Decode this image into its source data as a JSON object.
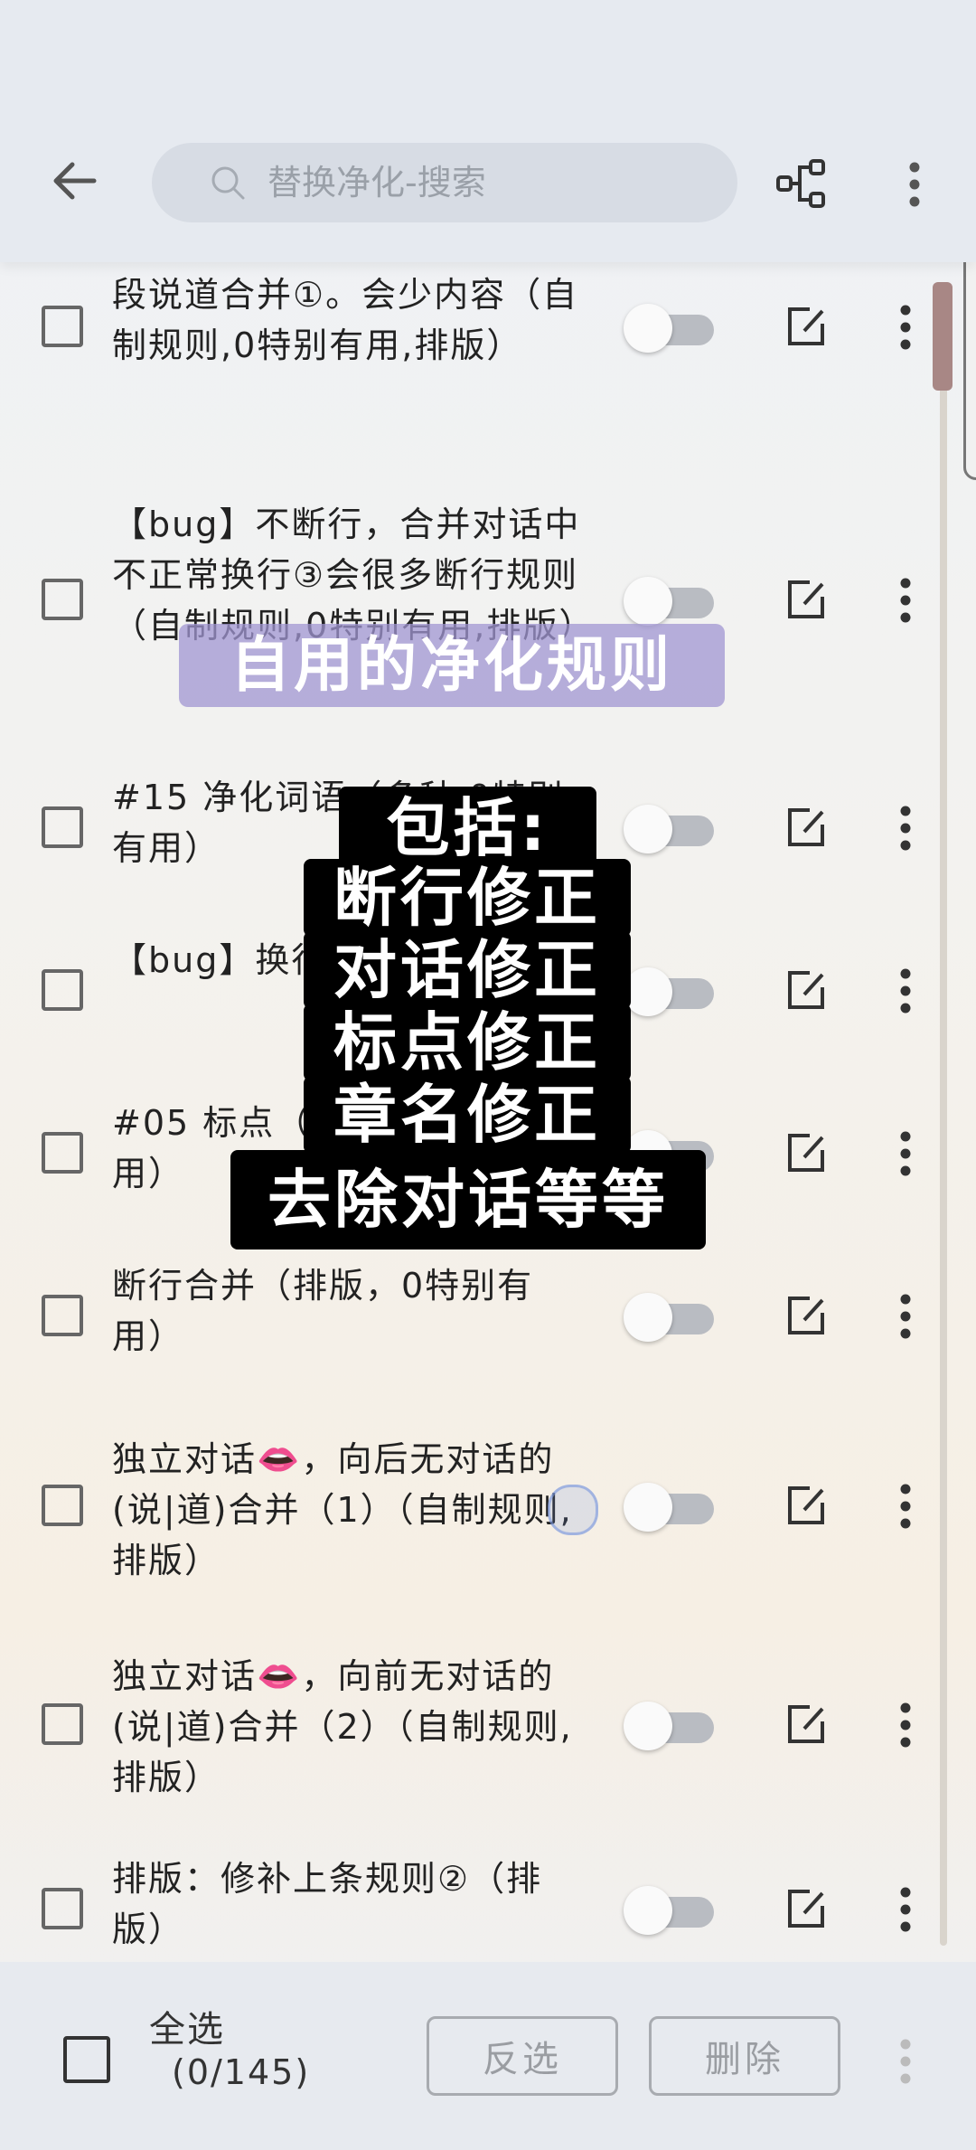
{
  "search": {
    "placeholder": "替换净化-搜索"
  },
  "rules": [
    {
      "label": "段说道合并①。会少内容（自制规则,0特别有用,排版）"
    },
    {
      "label": "【bug】不断行，合并对话中不正常换行③会很多断行规则（自制规则,0特别有用,排版）"
    },
    {
      "label": "#15 净化词语（多种,0特别有用）"
    },
    {
      "label": "【bug】换行（对话会断开）"
    },
    {
      "label": "#05 标点（多种,0特别有用）"
    },
    {
      "label": "断行合并（排版，0特别有用）"
    },
    {
      "label": "独立对话👄，向后无对话的(说|道)合并（1）（自制规则,排版）"
    },
    {
      "label": "独立对话👄，向前无对话的(说|道)合并（2）（自制规则,排版）"
    },
    {
      "label": "排版：修补上条规则②（排版）"
    }
  ],
  "bottom": {
    "select_all_label": "全选",
    "count": "(0/145)",
    "invert_label": "反选",
    "delete_label": "删除"
  },
  "overlay": {
    "title": "自用的净化规则",
    "lines": [
      "包括:",
      "断行修正",
      "对话修正",
      "标点修正",
      "章名修正",
      "去除对话等等"
    ]
  },
  "colors": {
    "toggle_off_track": "#b9bcc2",
    "scroll_thumb": "#a88785",
    "overlay_title_bg": "#a096d2"
  }
}
